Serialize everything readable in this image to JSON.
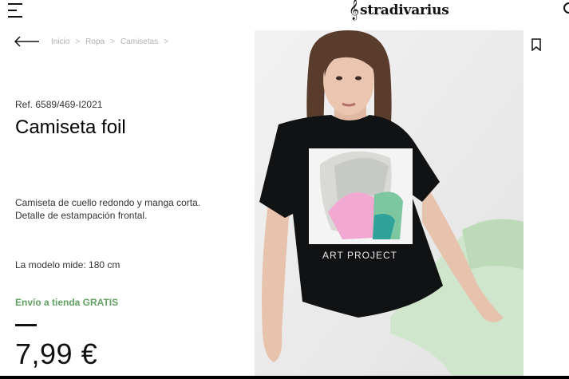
{
  "header": {
    "menu_icon": "hamburger-menu-icon",
    "logo_clef": "𝄞",
    "logo_text": "stradivarius",
    "search_icon": "search-icon"
  },
  "breadcrumb": {
    "back_icon": "arrow-left-icon",
    "items": [
      "Inicio",
      "Ropa",
      "Camisetas"
    ],
    "separator": ">"
  },
  "product": {
    "reference": "Ref. 6589/469-I2021",
    "name": "Camiseta foil",
    "description": "Camiseta de cuello redondo y manga corta. Detalle de estampación frontal.",
    "model_info": "La modelo mide: 180 cm",
    "shipping": "Envío a tienda GRATIS",
    "price": "7,99 €",
    "image_print_text": "ART PROJECT",
    "bookmark_icon": "bookmark-icon"
  },
  "colors": {
    "accent_green": "#62a062",
    "text": "#111111",
    "muted": "#b0b0b0"
  }
}
